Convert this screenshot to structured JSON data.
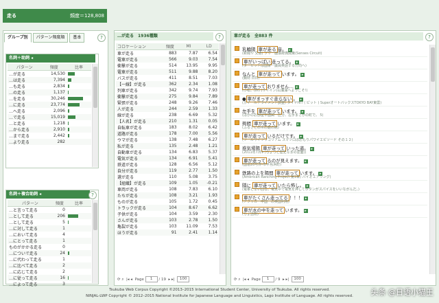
{
  "header": {
    "query": "走る",
    "frequency_label": "頻度＝128,808"
  },
  "left_tabs": [
    {
      "label": "グループ別"
    },
    {
      "label": "パターン頻度順"
    },
    {
      "label": "基本"
    }
  ],
  "pattern_group1": {
    "title": "名詞＋助詞 ◂",
    "columns": [
      "パターン",
      "頻度",
      "比率"
    ],
    "rows": [
      {
        "label": "…が走る",
        "freq": "14,530",
        "ratio": 0.34
      },
      {
        "label": "…は走る",
        "freq": "7,394",
        "ratio": 0.18
      },
      {
        "label": "…も走る",
        "freq": "2,834",
        "ratio": 0.07
      },
      {
        "label": "…の走る",
        "freq": "1,137",
        "ratio": 0.03
      },
      {
        "label": "…を走る",
        "freq": "30,246",
        "ratio": 0.72
      },
      {
        "label": "…に走る",
        "freq": "23,774",
        "ratio": 0.56
      },
      {
        "label": "…へ走る",
        "freq": "2,096",
        "ratio": 0.05
      },
      {
        "label": "…で走る",
        "freq": "15,019",
        "ratio": 0.36
      },
      {
        "label": "…と走る",
        "freq": "1,218",
        "ratio": 0.03
      },
      {
        "label": "…から走る",
        "freq": "2,910",
        "ratio": 0.07
      },
      {
        "label": "…まで走る",
        "freq": "2,442",
        "ratio": 0.06
      },
      {
        "label": "…より走る",
        "freq": "282",
        "ratio": 0.01
      }
    ]
  },
  "pattern_group2": {
    "title": "名詞＋複合助詞 ◂",
    "columns": [
      "パターン",
      "頻度",
      "比率"
    ],
    "rows": [
      {
        "label": "…と言って走る",
        "freq": "0",
        "ratio": 0
      },
      {
        "label": "…として走る",
        "freq": "206",
        "ratio": 0.5
      },
      {
        "label": "…として走る",
        "freq": "5",
        "ratio": 0.02
      },
      {
        "label": "…に対して走る",
        "freq": "1",
        "ratio": 0.01
      },
      {
        "label": "…において走る",
        "freq": "4",
        "ratio": 0.01
      },
      {
        "label": "…にとって走る",
        "freq": "1",
        "ratio": 0
      },
      {
        "label": "ものがかかる走る",
        "freq": "0",
        "ratio": 0
      },
      {
        "label": "…についで走る",
        "freq": "24",
        "ratio": 0.05
      },
      {
        "label": "…に代わって走る",
        "freq": "1",
        "ratio": 0
      },
      {
        "label": "…に比べて走る",
        "freq": "2",
        "ratio": 0
      },
      {
        "label": "…に応じて走る",
        "freq": "2",
        "ratio": 0
      },
      {
        "label": "…に従って走る",
        "freq": "16",
        "ratio": 0.04
      },
      {
        "label": "…によって走る",
        "freq": "3",
        "ratio": 0.01
      }
    ]
  },
  "collocations": {
    "title": "…が走る　1936種類",
    "columns": [
      "コロケーション",
      "頻度",
      "MI",
      "LD"
    ],
    "rows": [
      {
        "c": "車が走る",
        "f": "883",
        "mi": "7.87",
        "ld": "6.54"
      },
      {
        "c": "電車が走る",
        "f": "566",
        "mi": "9.03",
        "ld": "7.54"
      },
      {
        "c": "衝撃が走る",
        "f": "514",
        "mi": "13.95",
        "ld": "9.95"
      },
      {
        "c": "電車が走る",
        "f": "511",
        "mi": "9.88",
        "ld": "8.20"
      },
      {
        "c": "バスが走る",
        "f": "411",
        "mi": "8.51",
        "ld": "7.03"
      },
      {
        "c": "【一線】が走る",
        "f": "362",
        "mi": "2.34",
        "ld": "1.08"
      },
      {
        "c": "列車が走る",
        "f": "342",
        "mi": "9.74",
        "ld": "7.93"
      },
      {
        "c": "衝撃が走る",
        "f": "275",
        "mi": "9.84",
        "ld": "7.89"
      },
      {
        "c": "緊張が走る",
        "f": "248",
        "mi": "9.26",
        "ld": "7.46"
      },
      {
        "c": "人が走る",
        "f": "244",
        "mi": "2.59",
        "ld": "1.33"
      },
      {
        "c": "線が走る",
        "f": "238",
        "mi": "6.69",
        "ld": "5.32"
      },
      {
        "c": "【人名】が走る",
        "f": "210",
        "mi": "1.31",
        "ld": "0.05"
      },
      {
        "c": "自転車が走る",
        "f": "183",
        "mi": "8.02",
        "ld": "6.42"
      },
      {
        "c": "道路が走る",
        "f": "178",
        "mi": "7.00",
        "ld": "5.56"
      },
      {
        "c": "ウマが走る",
        "f": "138",
        "mi": "7.48",
        "ld": "6.27"
      },
      {
        "c": "私が走る",
        "f": "135",
        "mi": "2.48",
        "ld": "1.21"
      },
      {
        "c": "自動車が走る",
        "f": "134",
        "mi": "6.83",
        "ld": "5.37"
      },
      {
        "c": "電気が走る",
        "f": "134",
        "mi": "6.91",
        "ld": "5.41"
      },
      {
        "c": "鉄道が走る",
        "f": "128",
        "mi": "6.56",
        "ld": "5.12"
      },
      {
        "c": "自分が走る",
        "f": "119",
        "mi": "2.77",
        "ld": "1.50"
      },
      {
        "c": "選が走る",
        "f": "110",
        "mi": "5.08",
        "ld": "3.75"
      },
      {
        "c": "【組織】が走る",
        "f": "109",
        "mi": "1.05",
        "ld": "-0.21"
      },
      {
        "c": "車両が走る",
        "f": "108",
        "mi": "7.83",
        "ld": "6.10"
      },
      {
        "c": "たちが走る",
        "f": "108",
        "mi": "3.21",
        "ld": "1.93"
      },
      {
        "c": "ものが走る",
        "f": "105",
        "mi": "1.72",
        "ld": "0.45"
      },
      {
        "c": "トラックが走る",
        "f": "104",
        "mi": "8.67",
        "ld": "6.62"
      },
      {
        "c": "子供が走る",
        "f": "104",
        "mi": "3.59",
        "ld": "2.30"
      },
      {
        "c": "さんが走る",
        "f": "103",
        "mi": "2.78",
        "ld": "1.50"
      },
      {
        "c": "亀裂が走る",
        "f": "103",
        "mi": "11.09",
        "ld": "7.53"
      },
      {
        "c": "ほうが走る",
        "f": "91",
        "mi": "2.41",
        "ld": "1.14"
      }
    ],
    "pager": {
      "page_label": "Page",
      "page": "1",
      "of": "/ 19",
      "per_page": "100"
    }
  },
  "examples": {
    "title": "車が走る　全883 件",
    "items": [
      {
        "pre": "乳輪陽 ",
        "hl": "車が走る",
        "post": "音。",
        "src": "(新聞や 交通) フリー画像辞典関東(Senses Circuit)"
      },
      {
        "pre": "",
        "hl": "車がいっぱい",
        "post": "走ってる。",
        "src": "(ターセットは国家一議員英語する方向へ)"
      },
      {
        "pre": "なんと ",
        "hl": "車が走って",
        "post": "います。",
        "src": "(鋼材 日日)"
      },
      {
        "pre": "",
        "hl": "車が走って",
        "post": "おりません…",
        "src": "(小松、(昨) (サイイン)山瀬湖へようこそ!)"
      },
      {
        "pre": "●",
        "hl": "車がまっすぐ走らない",
        "post": "。",
        "src": "(ホイールアライメント調整) タイヤHIT ( ピット ) SuperオートバックスTOKYO BAY東雲)"
      },
      {
        "pre": "左手を ",
        "hl": "車が走って",
        "post": "います。",
        "src": "(ほかのお部屋平面図一区分、左手まさかの町で。 5)"
      },
      {
        "pre": "夠間 ",
        "hl": "車が走って",
        "post": "います。",
        "src": "(ふるさとの木の庭の館)"
      },
      {
        "pre": "",
        "hl": "車が走って",
        "post": "いるだけです。",
        "src": "(ツールサイツワゴリアム スマツロぼおもりパワイエピソード その１２)"
      },
      {
        "pre": "惑気場陽 ",
        "hl": "車が走って",
        "post": "いった道。",
        "src": "(2011年7月9 (ちょっと歴史なまの逆面))"
      },
      {
        "pre": "",
        "hl": "車が走って",
        "post": "るのが見えます。",
        "src": "(国道20号界-市平島浜町)"
      },
      {
        "pre": "鉄路の上を陽間 ",
        "hl": "車が走って",
        "post": "います。",
        "src": "(American Ranching Project 第1章) バイオエアリング)"
      },
      {
        "pre": "隣に ",
        "hl": "車が走って",
        "post": "いたら怖し。",
        "src": "(電車と早い回る。電気中で電気を押してボタンがスパイスをいいながんだ。)"
      },
      {
        "pre": "",
        "hl": "車がたくさん走ってる",
        "post": "！！！",
        "src": "(アフリカ一中国一の英国利用)"
      },
      {
        "pre": "",
        "hl": "車が水の中を走って",
        "post": "います。",
        "src": "(ちょ話術)"
      }
    ],
    "pager": {
      "page_label": "Page",
      "page": "1",
      "of": "/ 9",
      "per_page": "100"
    }
  },
  "footer": {
    "line1": "Tsukuba Web Corpus Copyright ©2013–2015 International Student Center, University of Tsukuba. All rights reserved.",
    "line2": "NINJAL-LWP Copyright © 2012–2015 National Institute for Japanese Language and Linguistics, Lago Institute of Language. All rights reserved."
  },
  "watermark": "头条 @日语小猫王",
  "colors": {
    "accent": "#3f8a4a",
    "highlight": "#e6a32c"
  }
}
